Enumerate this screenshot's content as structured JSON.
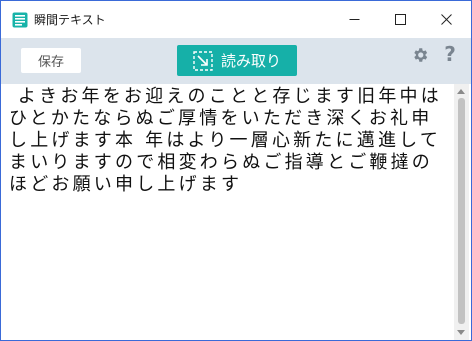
{
  "window": {
    "title": "瞬間テキスト",
    "app_icon": "notepad-icon",
    "controls": [
      "minimize-icon",
      "maximize-icon",
      "close-icon"
    ]
  },
  "toolbar": {
    "save_label": "保存",
    "ocr_label": "読み取り",
    "ocr_icon": "capture-region-icon",
    "settings_icon": "gear-icon",
    "help_icon": "question-mark-icon",
    "help_glyph": "?"
  },
  "editor": {
    "text": " よきお年をお迎えのことと存じます旧年中はひとかたならぬご厚情をいただき深くお礼申し上げます本 年はより一層心新たに邁進してまいりますので相変わらぬご指導とご鞭撻のほどお願い申し上げます"
  },
  "colors": {
    "accent": "#16b0a8",
    "toolbar_bg": "#dce4ec",
    "desktop": "#1f4fc4"
  }
}
